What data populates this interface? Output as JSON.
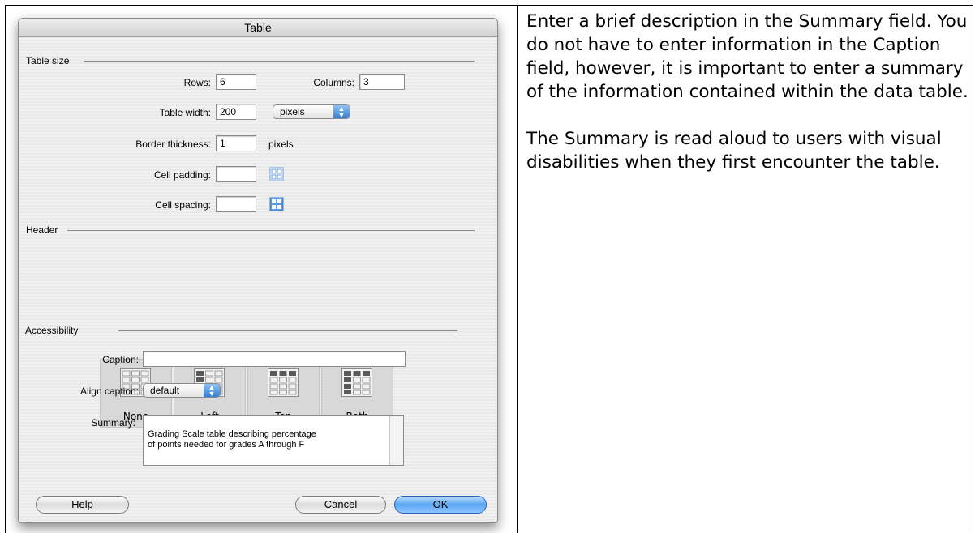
{
  "dialog": {
    "title": "Table",
    "table_size": {
      "group_label": "Table size",
      "rows_label": "Rows:",
      "rows_value": "6",
      "columns_label": "Columns:",
      "columns_value": "3",
      "width_label": "Table width:",
      "width_value": "200",
      "width_unit": "pixels",
      "border_label": "Border thickness:",
      "border_value": "1",
      "border_unit": "pixels",
      "padding_label": "Cell padding:",
      "padding_value": "",
      "spacing_label": "Cell spacing:",
      "spacing_value": ""
    },
    "header": {
      "group_label": "Header",
      "options": [
        "None",
        "Left",
        "Top",
        "Both"
      ]
    },
    "accessibility": {
      "group_label": "Accessibility",
      "caption_label": "Caption:",
      "caption_value": "",
      "align_label": "Align caption:",
      "align_value": "default",
      "summary_label": "Summary:",
      "summary_value": "Grading Scale table describing percentage\nof points needed for grades A through F"
    },
    "buttons": {
      "help": "Help",
      "cancel": "Cancel",
      "ok": "OK"
    }
  },
  "instructions": {
    "paragraph1": "Enter a brief description in the Summary field. You do not have to enter information in the Caption field, however, it is important to enter a summary of the information contained within the data table.",
    "paragraph2": "The Summary is read aloud to users with visual disabilities when they first encounter the table."
  },
  "colors": {
    "accent": "#3a8ae6",
    "dialog_bg": "#efefef"
  }
}
